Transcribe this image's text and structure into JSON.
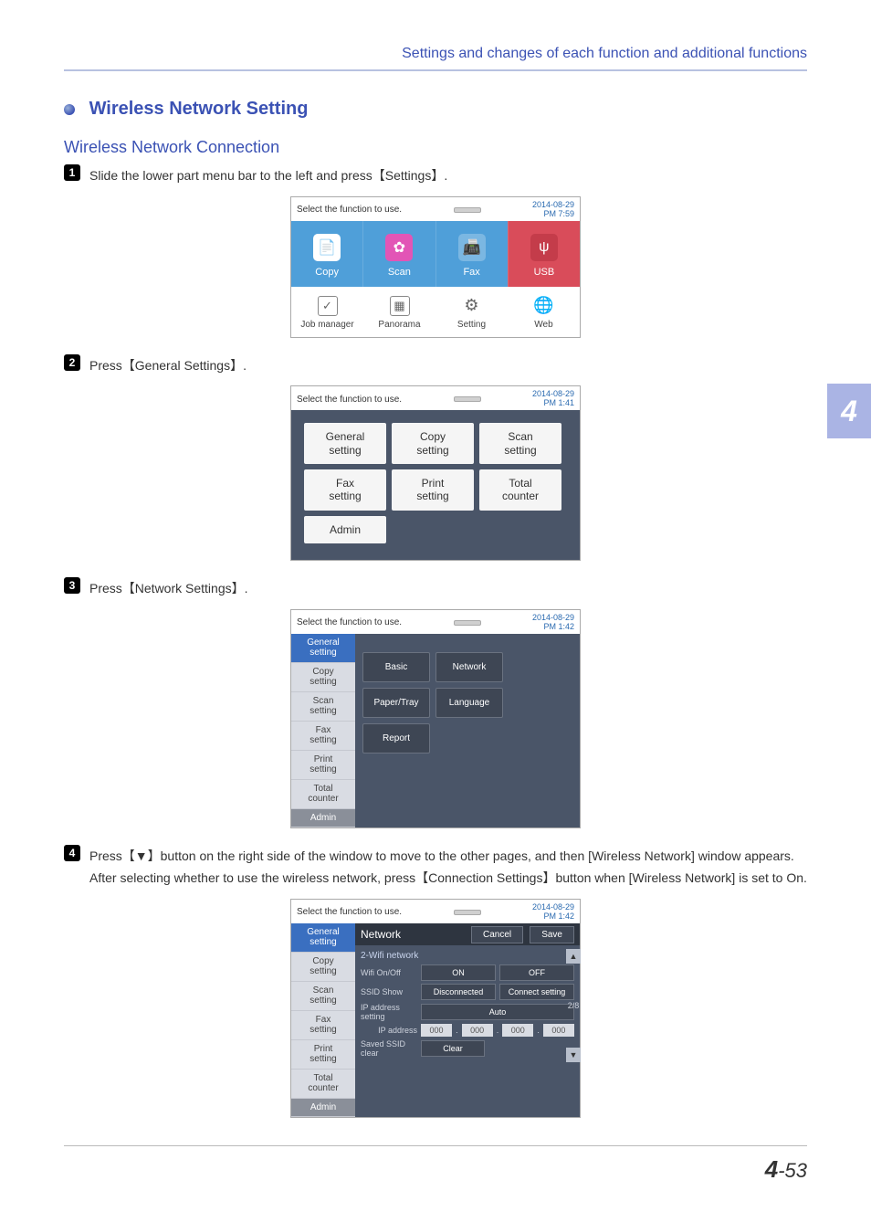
{
  "header": {
    "breadcrumb": "Settings and changes of each function and additional functions"
  },
  "section": {
    "title": "Wireless Network Setting",
    "subtitle": "Wireless Network Connection"
  },
  "chapter_tab": "4",
  "page_number": {
    "chapter": "4",
    "page": "53"
  },
  "steps": [
    {
      "n": "1",
      "text": "Slide the lower part menu bar to the left and press【Settings】."
    },
    {
      "n": "2",
      "text": "Press【General Settings】."
    },
    {
      "n": "3",
      "text": "Press【Network Settings】."
    },
    {
      "n": "4",
      "text": "Press【▼】button on the right side of the window to move to the other pages, and then [Wireless Network] window appears. After selecting whether to use the wireless network, press【Connection Settings】button when [Wireless Network] is set to On."
    }
  ],
  "ss_common": {
    "prompt": "Select the function to use."
  },
  "ss1": {
    "date": "2014-08-29",
    "time": "PM 7:59",
    "tiles": [
      "Copy",
      "Scan",
      "Fax",
      "USB"
    ],
    "lower": [
      "Job manager",
      "Panorama",
      "Setting",
      "Web"
    ]
  },
  "ss2": {
    "date": "2014-08-29",
    "time": "PM 1:41",
    "buttons": [
      "General setting",
      "Copy setting",
      "Scan setting",
      "Fax setting",
      "Print setting",
      "Total counter",
      "Admin"
    ]
  },
  "ss3": {
    "date": "2014-08-29",
    "time": "PM 1:42",
    "side": [
      "General setting",
      "Copy setting",
      "Scan setting",
      "Fax setting",
      "Print setting",
      "Total counter",
      "Admin"
    ],
    "buttons": [
      "Basic",
      "Network",
      "Paper/Tray",
      "Language",
      "Report"
    ]
  },
  "ss4": {
    "date": "2014-08-29",
    "time": "PM 1:42",
    "side": [
      "General setting",
      "Copy setting",
      "Scan setting",
      "Fax setting",
      "Print setting",
      "Total counter",
      "Admin"
    ],
    "title": "Network",
    "cancel": "Cancel",
    "save": "Save",
    "section": "2-Wifi network",
    "rows": {
      "wifi_label": "Wifi On/Off",
      "wifi_on": "ON",
      "wifi_off": "OFF",
      "ssid_label": "SSID Show",
      "ssid_status": "Disconnected",
      "ssid_btn": "Connect setting",
      "ipset_label": "IP address setting",
      "ipset_val": "Auto",
      "ip_label": "IP address",
      "ip": [
        "000",
        "000",
        "000",
        "000"
      ],
      "clear_label": "Saved SSID clear",
      "clear_btn": "Clear"
    },
    "page": "2/8"
  }
}
